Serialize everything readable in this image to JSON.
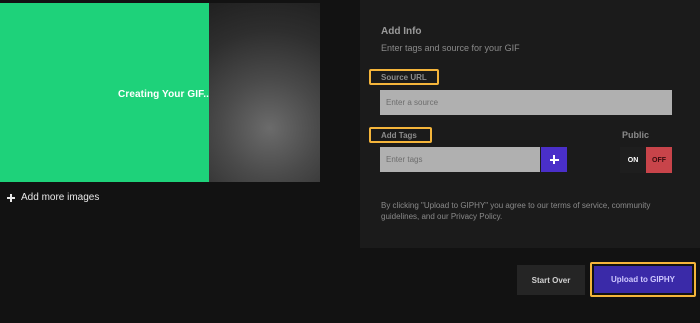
{
  "preview": {
    "status_text": "Creating Your GIF..",
    "add_more_label": "Add more images"
  },
  "info": {
    "title": "Add Info",
    "subtitle": "Enter tags and source for your GIF",
    "source_label": "Source URL",
    "source_placeholder": "Enter a source",
    "tags_label": "Add Tags",
    "tags_placeholder": "Enter tags",
    "public_label": "Public",
    "toggle_on": "ON",
    "toggle_off": "OFF",
    "terms": "By clicking \"Upload to GIPHY\" you agree to our terms of service, community guidelines, and our Privacy Policy."
  },
  "actions": {
    "start_over": "Start Over",
    "upload": "Upload to GIPHY"
  },
  "colors": {
    "overlay_green": "#1ed27a",
    "highlight": "#f5b53b",
    "primary_purple": "#3a2aa8",
    "toggle_off_red": "#c8444a"
  }
}
